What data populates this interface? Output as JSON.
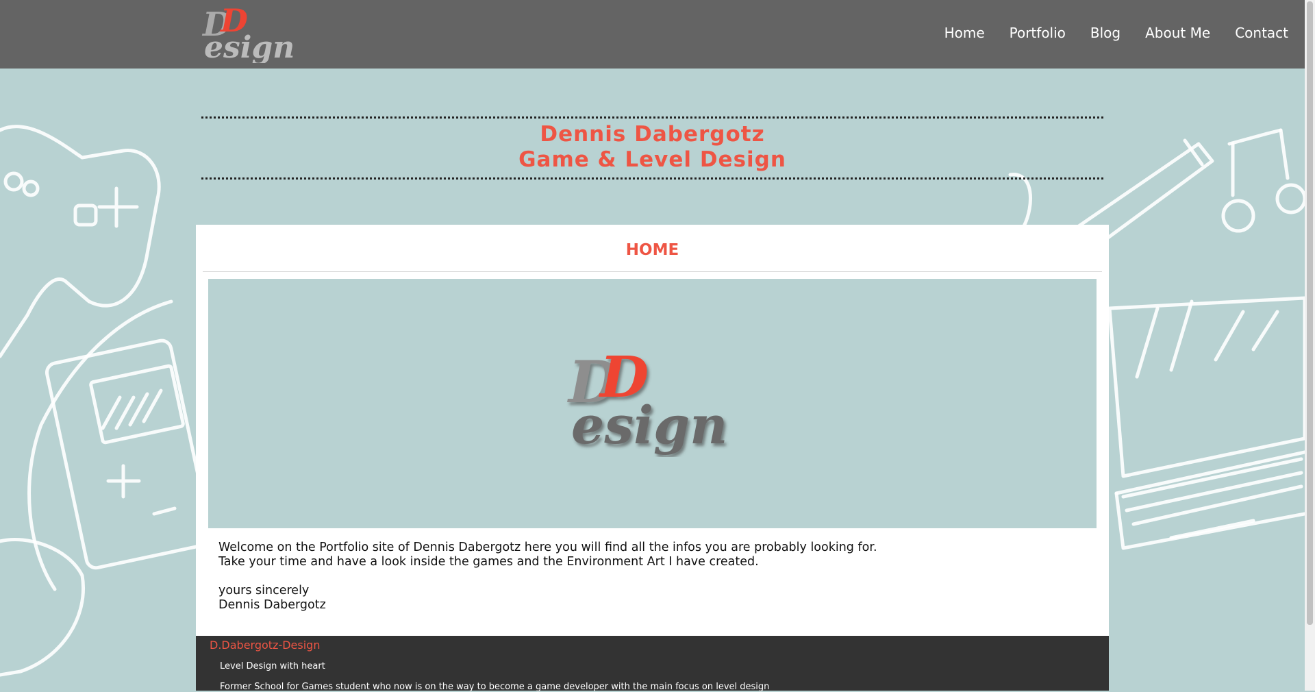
{
  "logo": {
    "alt": "DDesign"
  },
  "nav": {
    "items": [
      {
        "label": "Home"
      },
      {
        "label": "Portfolio"
      },
      {
        "label": "Blog"
      },
      {
        "label": "About Me"
      },
      {
        "label": "Contact"
      }
    ]
  },
  "banner": {
    "line1": "Dennis Dabergotz",
    "line2": "Game & Level Design"
  },
  "main": {
    "section_title": "HOME",
    "welcome_line1": "Welcome on the Portfolio site of Dennis Dabergotz here you will find all the infos you are probably looking for.",
    "welcome_line2": "Take your time and have a look inside the games and the Environment Art I have created.",
    "closing_line1": "yours sincerely",
    "closing_line2": "Dennis Dabergotz"
  },
  "footer": {
    "brand": "D.Dabergotz-Design",
    "tagline": "Level Design with heart",
    "description": "Former School for Games student who now is on the way to become a game developer with the main focus on level design"
  },
  "colors": {
    "accent": "#ee5544",
    "header_bg": "#646464",
    "page_bg": "#b8d2d2",
    "footer_bg": "#333333"
  }
}
